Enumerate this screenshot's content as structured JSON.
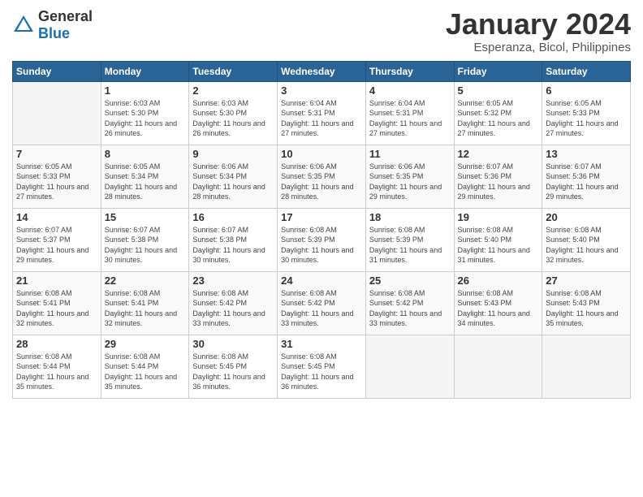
{
  "header": {
    "logo_general": "General",
    "logo_blue": "Blue",
    "title": "January 2024",
    "subtitle": "Esperanza, Bicol, Philippines"
  },
  "days_of_week": [
    "Sunday",
    "Monday",
    "Tuesday",
    "Wednesday",
    "Thursday",
    "Friday",
    "Saturday"
  ],
  "weeks": [
    [
      {
        "day": "",
        "sunrise": "",
        "sunset": "",
        "daylight": ""
      },
      {
        "day": "1",
        "sunrise": "6:03 AM",
        "sunset": "5:30 PM",
        "daylight": "11 hours and 26 minutes."
      },
      {
        "day": "2",
        "sunrise": "6:03 AM",
        "sunset": "5:30 PM",
        "daylight": "11 hours and 26 minutes."
      },
      {
        "day": "3",
        "sunrise": "6:04 AM",
        "sunset": "5:31 PM",
        "daylight": "11 hours and 27 minutes."
      },
      {
        "day": "4",
        "sunrise": "6:04 AM",
        "sunset": "5:31 PM",
        "daylight": "11 hours and 27 minutes."
      },
      {
        "day": "5",
        "sunrise": "6:05 AM",
        "sunset": "5:32 PM",
        "daylight": "11 hours and 27 minutes."
      },
      {
        "day": "6",
        "sunrise": "6:05 AM",
        "sunset": "5:33 PM",
        "daylight": "11 hours and 27 minutes."
      }
    ],
    [
      {
        "day": "7",
        "sunrise": "6:05 AM",
        "sunset": "5:33 PM",
        "daylight": "11 hours and 27 minutes."
      },
      {
        "day": "8",
        "sunrise": "6:05 AM",
        "sunset": "5:34 PM",
        "daylight": "11 hours and 28 minutes."
      },
      {
        "day": "9",
        "sunrise": "6:06 AM",
        "sunset": "5:34 PM",
        "daylight": "11 hours and 28 minutes."
      },
      {
        "day": "10",
        "sunrise": "6:06 AM",
        "sunset": "5:35 PM",
        "daylight": "11 hours and 28 minutes."
      },
      {
        "day": "11",
        "sunrise": "6:06 AM",
        "sunset": "5:35 PM",
        "daylight": "11 hours and 29 minutes."
      },
      {
        "day": "12",
        "sunrise": "6:07 AM",
        "sunset": "5:36 PM",
        "daylight": "11 hours and 29 minutes."
      },
      {
        "day": "13",
        "sunrise": "6:07 AM",
        "sunset": "5:36 PM",
        "daylight": "11 hours and 29 minutes."
      }
    ],
    [
      {
        "day": "14",
        "sunrise": "6:07 AM",
        "sunset": "5:37 PM",
        "daylight": "11 hours and 29 minutes."
      },
      {
        "day": "15",
        "sunrise": "6:07 AM",
        "sunset": "5:38 PM",
        "daylight": "11 hours and 30 minutes."
      },
      {
        "day": "16",
        "sunrise": "6:07 AM",
        "sunset": "5:38 PM",
        "daylight": "11 hours and 30 minutes."
      },
      {
        "day": "17",
        "sunrise": "6:08 AM",
        "sunset": "5:39 PM",
        "daylight": "11 hours and 30 minutes."
      },
      {
        "day": "18",
        "sunrise": "6:08 AM",
        "sunset": "5:39 PM",
        "daylight": "11 hours and 31 minutes."
      },
      {
        "day": "19",
        "sunrise": "6:08 AM",
        "sunset": "5:40 PM",
        "daylight": "11 hours and 31 minutes."
      },
      {
        "day": "20",
        "sunrise": "6:08 AM",
        "sunset": "5:40 PM",
        "daylight": "11 hours and 32 minutes."
      }
    ],
    [
      {
        "day": "21",
        "sunrise": "6:08 AM",
        "sunset": "5:41 PM",
        "daylight": "11 hours and 32 minutes."
      },
      {
        "day": "22",
        "sunrise": "6:08 AM",
        "sunset": "5:41 PM",
        "daylight": "11 hours and 32 minutes."
      },
      {
        "day": "23",
        "sunrise": "6:08 AM",
        "sunset": "5:42 PM",
        "daylight": "11 hours and 33 minutes."
      },
      {
        "day": "24",
        "sunrise": "6:08 AM",
        "sunset": "5:42 PM",
        "daylight": "11 hours and 33 minutes."
      },
      {
        "day": "25",
        "sunrise": "6:08 AM",
        "sunset": "5:42 PM",
        "daylight": "11 hours and 33 minutes."
      },
      {
        "day": "26",
        "sunrise": "6:08 AM",
        "sunset": "5:43 PM",
        "daylight": "11 hours and 34 minutes."
      },
      {
        "day": "27",
        "sunrise": "6:08 AM",
        "sunset": "5:43 PM",
        "daylight": "11 hours and 35 minutes."
      }
    ],
    [
      {
        "day": "28",
        "sunrise": "6:08 AM",
        "sunset": "5:44 PM",
        "daylight": "11 hours and 35 minutes."
      },
      {
        "day": "29",
        "sunrise": "6:08 AM",
        "sunset": "5:44 PM",
        "daylight": "11 hours and 35 minutes."
      },
      {
        "day": "30",
        "sunrise": "6:08 AM",
        "sunset": "5:45 PM",
        "daylight": "11 hours and 36 minutes."
      },
      {
        "day": "31",
        "sunrise": "6:08 AM",
        "sunset": "5:45 PM",
        "daylight": "11 hours and 36 minutes."
      },
      {
        "day": "",
        "sunrise": "",
        "sunset": "",
        "daylight": ""
      },
      {
        "day": "",
        "sunrise": "",
        "sunset": "",
        "daylight": ""
      },
      {
        "day": "",
        "sunrise": "",
        "sunset": "",
        "daylight": ""
      }
    ]
  ]
}
